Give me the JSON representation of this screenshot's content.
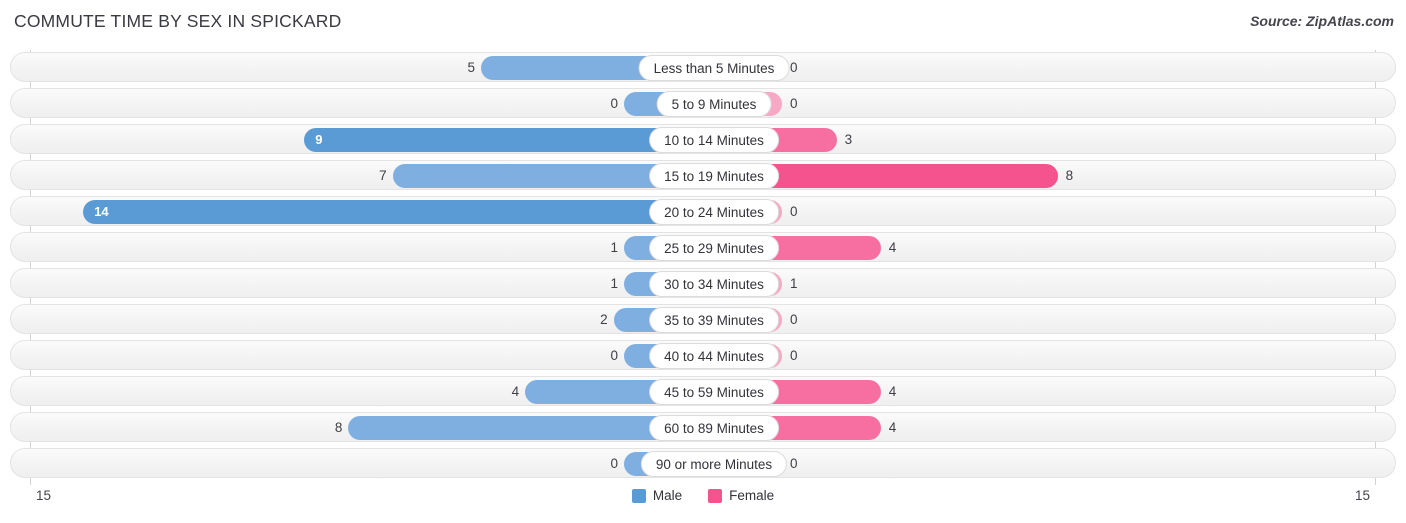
{
  "header": {
    "title": "COMMUTE TIME BY SEX IN SPICKARD",
    "source": "Source: ZipAtlas.com"
  },
  "legend": {
    "male_label": "Male",
    "female_label": "Female",
    "male_color": "#5B9BD5",
    "female_color": "#F4538E"
  },
  "axis": {
    "left_tick": "15",
    "right_tick": "15"
  },
  "chart_data": {
    "type": "bar",
    "title": "COMMUTE TIME BY SEX IN SPICKARD",
    "subtitle": "Source: ZipAtlas.com",
    "orientation": "horizontal-diverging",
    "xlabel": "",
    "ylabel": "",
    "xlim": [
      -15,
      15
    ],
    "axis_max": 15,
    "grid": false,
    "legend_position": "bottom-center",
    "categories": [
      "Less than 5 Minutes",
      "5 to 9 Minutes",
      "10 to 14 Minutes",
      "15 to 19 Minutes",
      "20 to 24 Minutes",
      "25 to 29 Minutes",
      "30 to 34 Minutes",
      "35 to 39 Minutes",
      "40 to 44 Minutes",
      "45 to 59 Minutes",
      "60 to 89 Minutes",
      "90 or more Minutes"
    ],
    "series": [
      {
        "name": "Male",
        "color": "#5B9BD5",
        "values": [
          5,
          0,
          9,
          7,
          14,
          1,
          1,
          2,
          0,
          4,
          8,
          0
        ]
      },
      {
        "name": "Female",
        "color": "#F4538E",
        "values": [
          0,
          0,
          3,
          8,
          0,
          4,
          1,
          0,
          0,
          4,
          4,
          0
        ]
      }
    ]
  },
  "rows": [
    {
      "category": "Less than 5 Minutes",
      "male": "5",
      "female": "0",
      "male_val": 5,
      "female_val": 0
    },
    {
      "category": "5 to 9 Minutes",
      "male": "0",
      "female": "0",
      "male_val": 0,
      "female_val": 0
    },
    {
      "category": "10 to 14 Minutes",
      "male": "9",
      "female": "3",
      "male_val": 9,
      "female_val": 3
    },
    {
      "category": "15 to 19 Minutes",
      "male": "7",
      "female": "8",
      "male_val": 7,
      "female_val": 8
    },
    {
      "category": "20 to 24 Minutes",
      "male": "14",
      "female": "0",
      "male_val": 14,
      "female_val": 0
    },
    {
      "category": "25 to 29 Minutes",
      "male": "1",
      "female": "4",
      "male_val": 1,
      "female_val": 4
    },
    {
      "category": "30 to 34 Minutes",
      "male": "1",
      "female": "1",
      "male_val": 1,
      "female_val": 1
    },
    {
      "category": "35 to 39 Minutes",
      "male": "2",
      "female": "0",
      "male_val": 2,
      "female_val": 0
    },
    {
      "category": "40 to 44 Minutes",
      "male": "0",
      "female": "0",
      "male_val": 0,
      "female_val": 0
    },
    {
      "category": "45 to 59 Minutes",
      "male": "4",
      "female": "4",
      "male_val": 4,
      "female_val": 4
    },
    {
      "category": "60 to 89 Minutes",
      "male": "8",
      "female": "4",
      "male_val": 8,
      "female_val": 4
    },
    {
      "category": "90 or more Minutes",
      "male": "0",
      "female": "0",
      "male_val": 0,
      "female_val": 0
    }
  ]
}
